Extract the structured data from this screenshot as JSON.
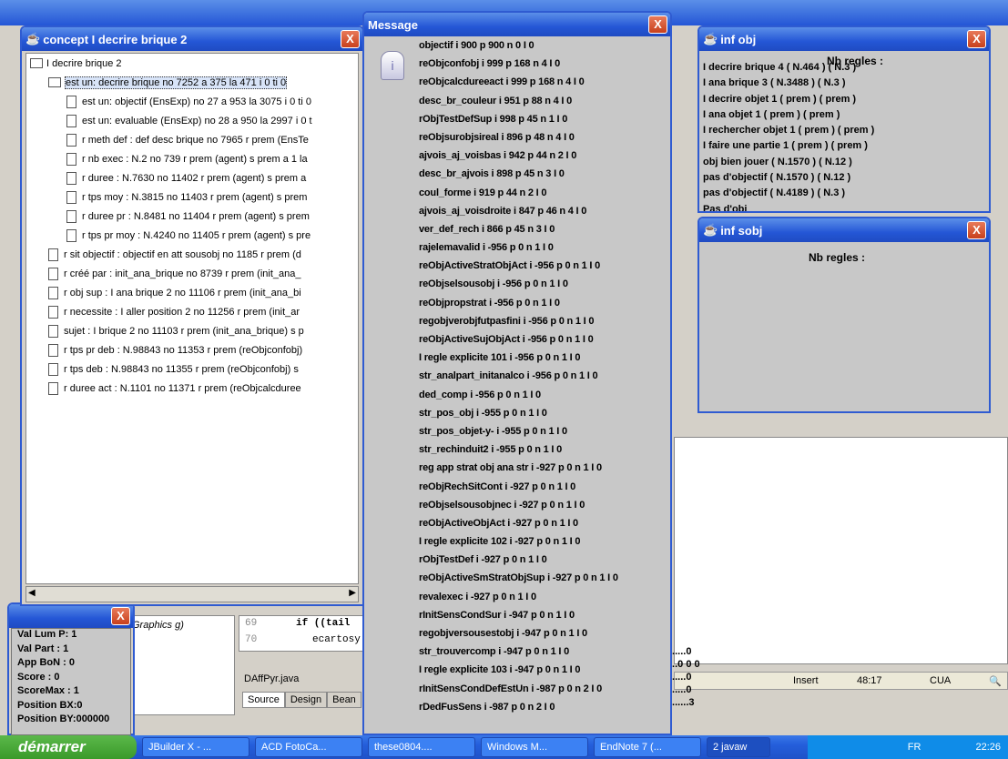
{
  "concept_window": {
    "title": "concept I decrire brique 2",
    "close": "X",
    "tree": [
      {
        "label": "I decrire brique 2",
        "level": 0,
        "kind": "folder"
      },
      {
        "label": "est un: decrire brique no 7252 a 375 la 471 i 0 ti 0",
        "level": 1,
        "kind": "folder"
      },
      {
        "label": "est un: objectif (EnsExp) no 27 a 953 la 3075 i 0 ti 0",
        "level": 2,
        "kind": "doc"
      },
      {
        "label": "est un: evaluable (EnsExp) no 28 a 950 la 2997 i 0 t",
        "level": 2,
        "kind": "doc"
      },
      {
        "label": "r meth def : def desc brique no 7965 r prem (EnsTe",
        "level": 2,
        "kind": "doc"
      },
      {
        "label": "r nb exec : N.2 no 739 r prem (agent) s prem a 1 la",
        "level": 2,
        "kind": "doc"
      },
      {
        "label": "r duree : N.7630 no 11402 r prem (agent) s prem a",
        "level": 2,
        "kind": "doc"
      },
      {
        "label": "r tps moy : N.3815 no 11403 r prem (agent) s prem",
        "level": 2,
        "kind": "doc"
      },
      {
        "label": "r duree pr : N.8481 no 11404 r prem (agent) s prem",
        "level": 2,
        "kind": "doc"
      },
      {
        "label": "r tps pr moy : N.4240 no 11405 r prem (agent) s pre",
        "level": 2,
        "kind": "doc"
      },
      {
        "label": "r sit objectif : objectif en att sousobj no 1185 r prem (d",
        "level": 1,
        "kind": "doc"
      },
      {
        "label": "r créé par : init_ana_brique no 8739 r prem (init_ana_",
        "level": 1,
        "kind": "doc"
      },
      {
        "label": "r obj sup : I ana brique 2 no 11106 r prem (init_ana_bi",
        "level": 1,
        "kind": "doc"
      },
      {
        "label": "r necessite : I aller position 2 no 11256 r prem (init_ar",
        "level": 1,
        "kind": "doc"
      },
      {
        "label": "sujet : I brique 2 no 11103 r prem (init_ana_brique) s p",
        "level": 1,
        "kind": "doc"
      },
      {
        "label": "r tps pr deb : N.98843 no 11353 r prem (reObjconfobj)",
        "level": 1,
        "kind": "doc"
      },
      {
        "label": "r tps deb : N.98843 no 11355 r prem (reObjconfobj) s",
        "level": 1,
        "kind": "doc"
      },
      {
        "label": "r duree act : N.1101 no 11371 r prem (reObjcalcduree",
        "level": 1,
        "kind": "doc"
      }
    ]
  },
  "message_window": {
    "title": "Message",
    "close": "X",
    "lines": [
      "objectif i 900 p 900 n 0 I 0",
      "reObjconfobj i 999 p 168 n 4 I 0",
      "reObjcalcdureeact i 999 p 168 n 4 I 0",
      "desc_br_couleur i 951 p 88 n 4 I 0",
      "rObjTestDefSup i 998 p 45 n 1 I 0",
      "reObjsurobjsireal i 896 p 48 n 4 I 0",
      "ajvois_aj_voisbas i 942 p 44 n 2 I 0",
      "desc_br_ajvois i 898 p 45 n 3 I 0",
      "coul_forme i 919 p 44 n 2 I 0",
      "ajvois_aj_voisdroite i 847 p 46 n 4 I 0",
      "ver_def_rech i 866 p 45 n 3 I 0",
      "rajelemavalid i -956 p 0 n 1 I 0",
      "reObjActiveStratObjAct i -956 p 0 n 1 I 0",
      "reObjselsousobj i -956 p 0 n 1 I 0",
      "reObjpropstrat i -956 p 0 n 1 I 0",
      "regobjverobjfutpasfini i -956 p 0 n 1 I 0",
      "reObjActiveSujObjAct i -956 p 0 n 1 I 0",
      "I regle explicite 101 i -956 p 0 n 1 I 0",
      "str_analpart_initanalco i -956 p 0 n 1 I 0",
      "ded_comp i -956 p 0 n 1 I 0",
      "str_pos_obj i -955 p 0 n 1 I 0",
      "str_pos_objet-y- i -955 p 0 n 1 I 0",
      "str_rechinduit2 i -955 p 0 n 1 I 0",
      "reg app strat obj ana str i -927 p 0 n 1 I 0",
      "reObjRechSitCont i -927 p 0 n 1 I 0",
      "reObjselsousobjnec i -927 p 0 n 1 I 0",
      "reObjActiveObjAct i -927 p 0 n 1 I 0",
      "I regle explicite 102 i -927 p 0 n 1 I 0",
      "rObjTestDef i -927 p 0 n 1 I 0",
      "reObjActiveSmStratObjSup i -927 p 0 n 1 I 0",
      "revalexec i -927 p 0 n 1 I 0",
      "rInitSensCondSur i -947 p 0 n 1 I 0",
      "regobjversousestobj i -947 p 0 n 1 I 0",
      "str_trouvercomp i -947 p 0 n 1 I 0",
      "I regle explicite 103 i -947 p 0 n 1 I 0",
      "rInitSensCondDefEstUn i -987 p 0 n 2 I 0",
      "rDedFusSens i -987 p 0 n 2 I 0"
    ]
  },
  "inf_obj_window": {
    "title": "inf obj",
    "close": "X",
    "header": "Nb regles :",
    "lines": [
      "I decrire brique 4 ( N.464 ) ( N.3 )",
      "I ana brique 3 ( N.3488 ) ( N.3 )",
      "I decrire objet 1 ( prem ) ( prem )",
      "I ana objet 1 ( prem ) ( prem )",
      "I rechercher objet 1 ( prem ) ( prem )",
      "I faire une partie 1 ( prem ) ( prem )",
      "obj bien jouer ( N.1570 ) ( N.12 )",
      "pas d'objectif ( N.1570 ) ( N.12 )",
      "pas d'objectif ( N.4189 ) ( N.3 )",
      "Pas d'obj"
    ]
  },
  "inf_sobj_window": {
    "title": "inf sobj",
    "close": "X",
    "header": "Nb regles :"
  },
  "score_panel": {
    "lines": [
      "Val Lum P: 1",
      "Val Part : 1",
      "App BoN : 0",
      "Score : 0",
      "ScoreMax : 1",
      "Position BX:0",
      "Position BY:000000"
    ]
  },
  "editor": {
    "line_numbers": [
      "69",
      "70"
    ],
    "code_line1": "if ((tail",
    "code_line2": "ecartosy",
    "left_code": "Graphics g)",
    "file_name": "DAffPyr.java",
    "tabs": [
      "Source",
      "Design",
      "Bean"
    ],
    "status_insert": "Insert",
    "status_pos": "48:17",
    "status_mode": "CUA",
    "dots": [
      "......0",
      "...0 0 0",
      "......0",
      "......0",
      ".......3"
    ]
  },
  "taskbar": {
    "start": "démarrer",
    "tasks": [
      "JBuilder X - ...",
      "ACD FotoCa...",
      "these0804....",
      "Windows M...",
      "EndNote 7 (...",
      "2 javaw"
    ],
    "lang": "FR",
    "clock": "22:26"
  },
  "colors": {
    "titlebar": "#2456d6",
    "close": "#d9532c",
    "window": "#d4d0c8",
    "panel": "#c8c8c8"
  }
}
